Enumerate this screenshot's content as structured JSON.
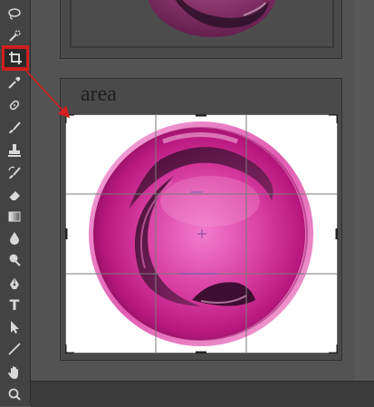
{
  "panel": {
    "label": "area"
  },
  "tools": [
    {
      "name": "lasso-tool-icon",
      "glyph": ""
    },
    {
      "name": "quick-selection-tool-icon",
      "glyph": ""
    },
    {
      "name": "crop-tool-icon",
      "glyph": "",
      "selected": true
    },
    {
      "name": "eyedropper-tool-icon",
      "glyph": ""
    },
    {
      "name": "healing-brush-tool-icon",
      "glyph": ""
    },
    {
      "name": "brush-tool-icon",
      "glyph": ""
    },
    {
      "name": "clone-stamp-tool-icon",
      "glyph": ""
    },
    {
      "name": "history-brush-tool-icon",
      "glyph": ""
    },
    {
      "name": "eraser-tool-icon",
      "glyph": ""
    },
    {
      "name": "gradient-tool-icon",
      "glyph": ""
    },
    {
      "name": "blur-tool-icon",
      "glyph": ""
    },
    {
      "name": "dodge-tool-icon",
      "glyph": ""
    },
    {
      "name": "pen-tool-icon",
      "glyph": ""
    },
    {
      "name": "type-tool-icon",
      "glyph": "T"
    },
    {
      "name": "path-selection-tool-icon",
      "glyph": ""
    },
    {
      "name": "line-tool-icon",
      "glyph": ""
    },
    {
      "name": "hand-tool-icon",
      "glyph": ""
    },
    {
      "name": "zoom-tool-icon",
      "glyph": ""
    }
  ],
  "colors": {
    "highlight": "#d41f1f",
    "magenta": "#c0157a",
    "magenta_light": "#f07ac8",
    "magenta_dark": "#6e0f4a"
  }
}
